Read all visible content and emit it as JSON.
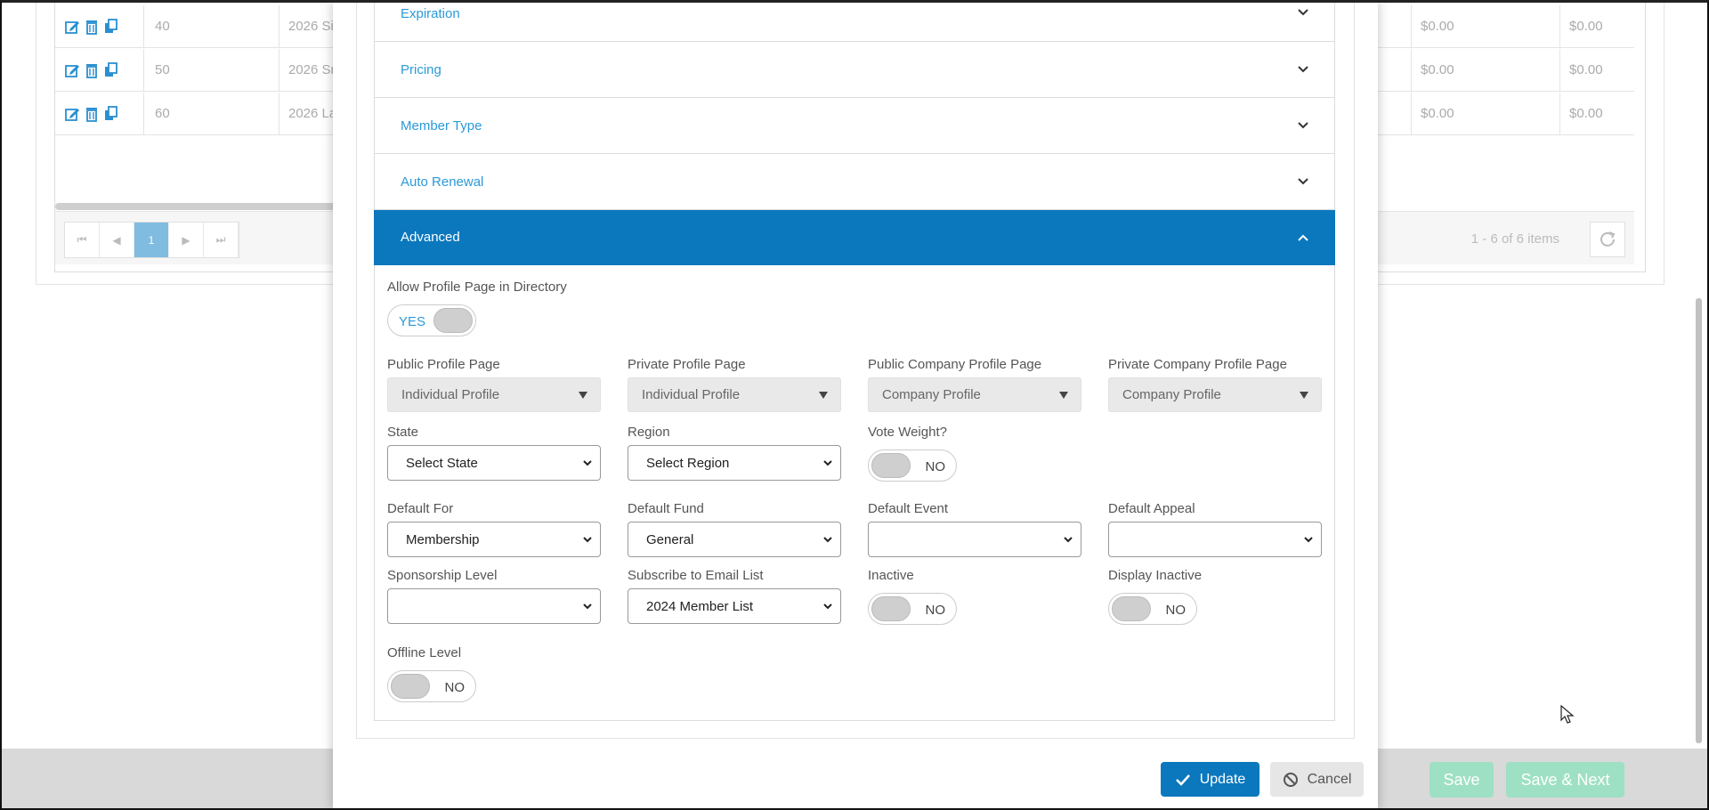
{
  "background": {
    "rows": [
      {
        "num": "40",
        "name": "2026 Si",
        "col_a": "$0.00",
        "col_b": "$0.00"
      },
      {
        "num": "50",
        "name": "2026 Sr",
        "col_a": "$0.00",
        "col_b": "$0.00"
      },
      {
        "num": "60",
        "name": "2026 La",
        "col_a": "$0.00",
        "col_b": "$0.00"
      }
    ],
    "pager": {
      "current_page": "1",
      "info": "1 - 6 of 6 items"
    },
    "footer": {
      "save_label": "Save",
      "save_next_label": "Save & Next"
    }
  },
  "modal": {
    "sections": {
      "expiration": "Expiration",
      "pricing": "Pricing",
      "member_type": "Member Type",
      "auto_renewal": "Auto Renewal",
      "advanced": "Advanced"
    },
    "advanced": {
      "allow_profile": {
        "label": "Allow Profile Page in Directory",
        "value": "YES"
      },
      "public_profile": {
        "label": "Public Profile Page",
        "value": "Individual Profile"
      },
      "private_profile": {
        "label": "Private Profile Page",
        "value": "Individual Profile"
      },
      "public_company": {
        "label": "Public Company Profile Page",
        "value": "Company Profile"
      },
      "private_company": {
        "label": "Private Company Profile Page",
        "value": "Company Profile"
      },
      "state": {
        "label": "State",
        "value": "Select State"
      },
      "region": {
        "label": "Region",
        "value": "Select Region"
      },
      "vote_weight": {
        "label": "Vote Weight?",
        "value": "NO"
      },
      "default_for": {
        "label": "Default For",
        "value": "Membership"
      },
      "default_fund": {
        "label": "Default Fund",
        "value": "General"
      },
      "default_event": {
        "label": "Default Event",
        "value": ""
      },
      "default_appeal": {
        "label": "Default Appeal",
        "value": ""
      },
      "sponsorship": {
        "label": "Sponsorship Level",
        "value": ""
      },
      "subscribe": {
        "label": "Subscribe to Email List",
        "value": "2024 Member List"
      },
      "inactive": {
        "label": "Inactive",
        "value": "NO"
      },
      "display_inactive": {
        "label": "Display Inactive",
        "value": "NO"
      },
      "offline": {
        "label": "Offline Level",
        "value": "NO"
      }
    },
    "buttons": {
      "update": "Update",
      "cancel": "Cancel"
    }
  },
  "colors": {
    "accent": "#0b78bd",
    "link": "#2b9ad8",
    "save_disabled": "#9ee0c3"
  }
}
